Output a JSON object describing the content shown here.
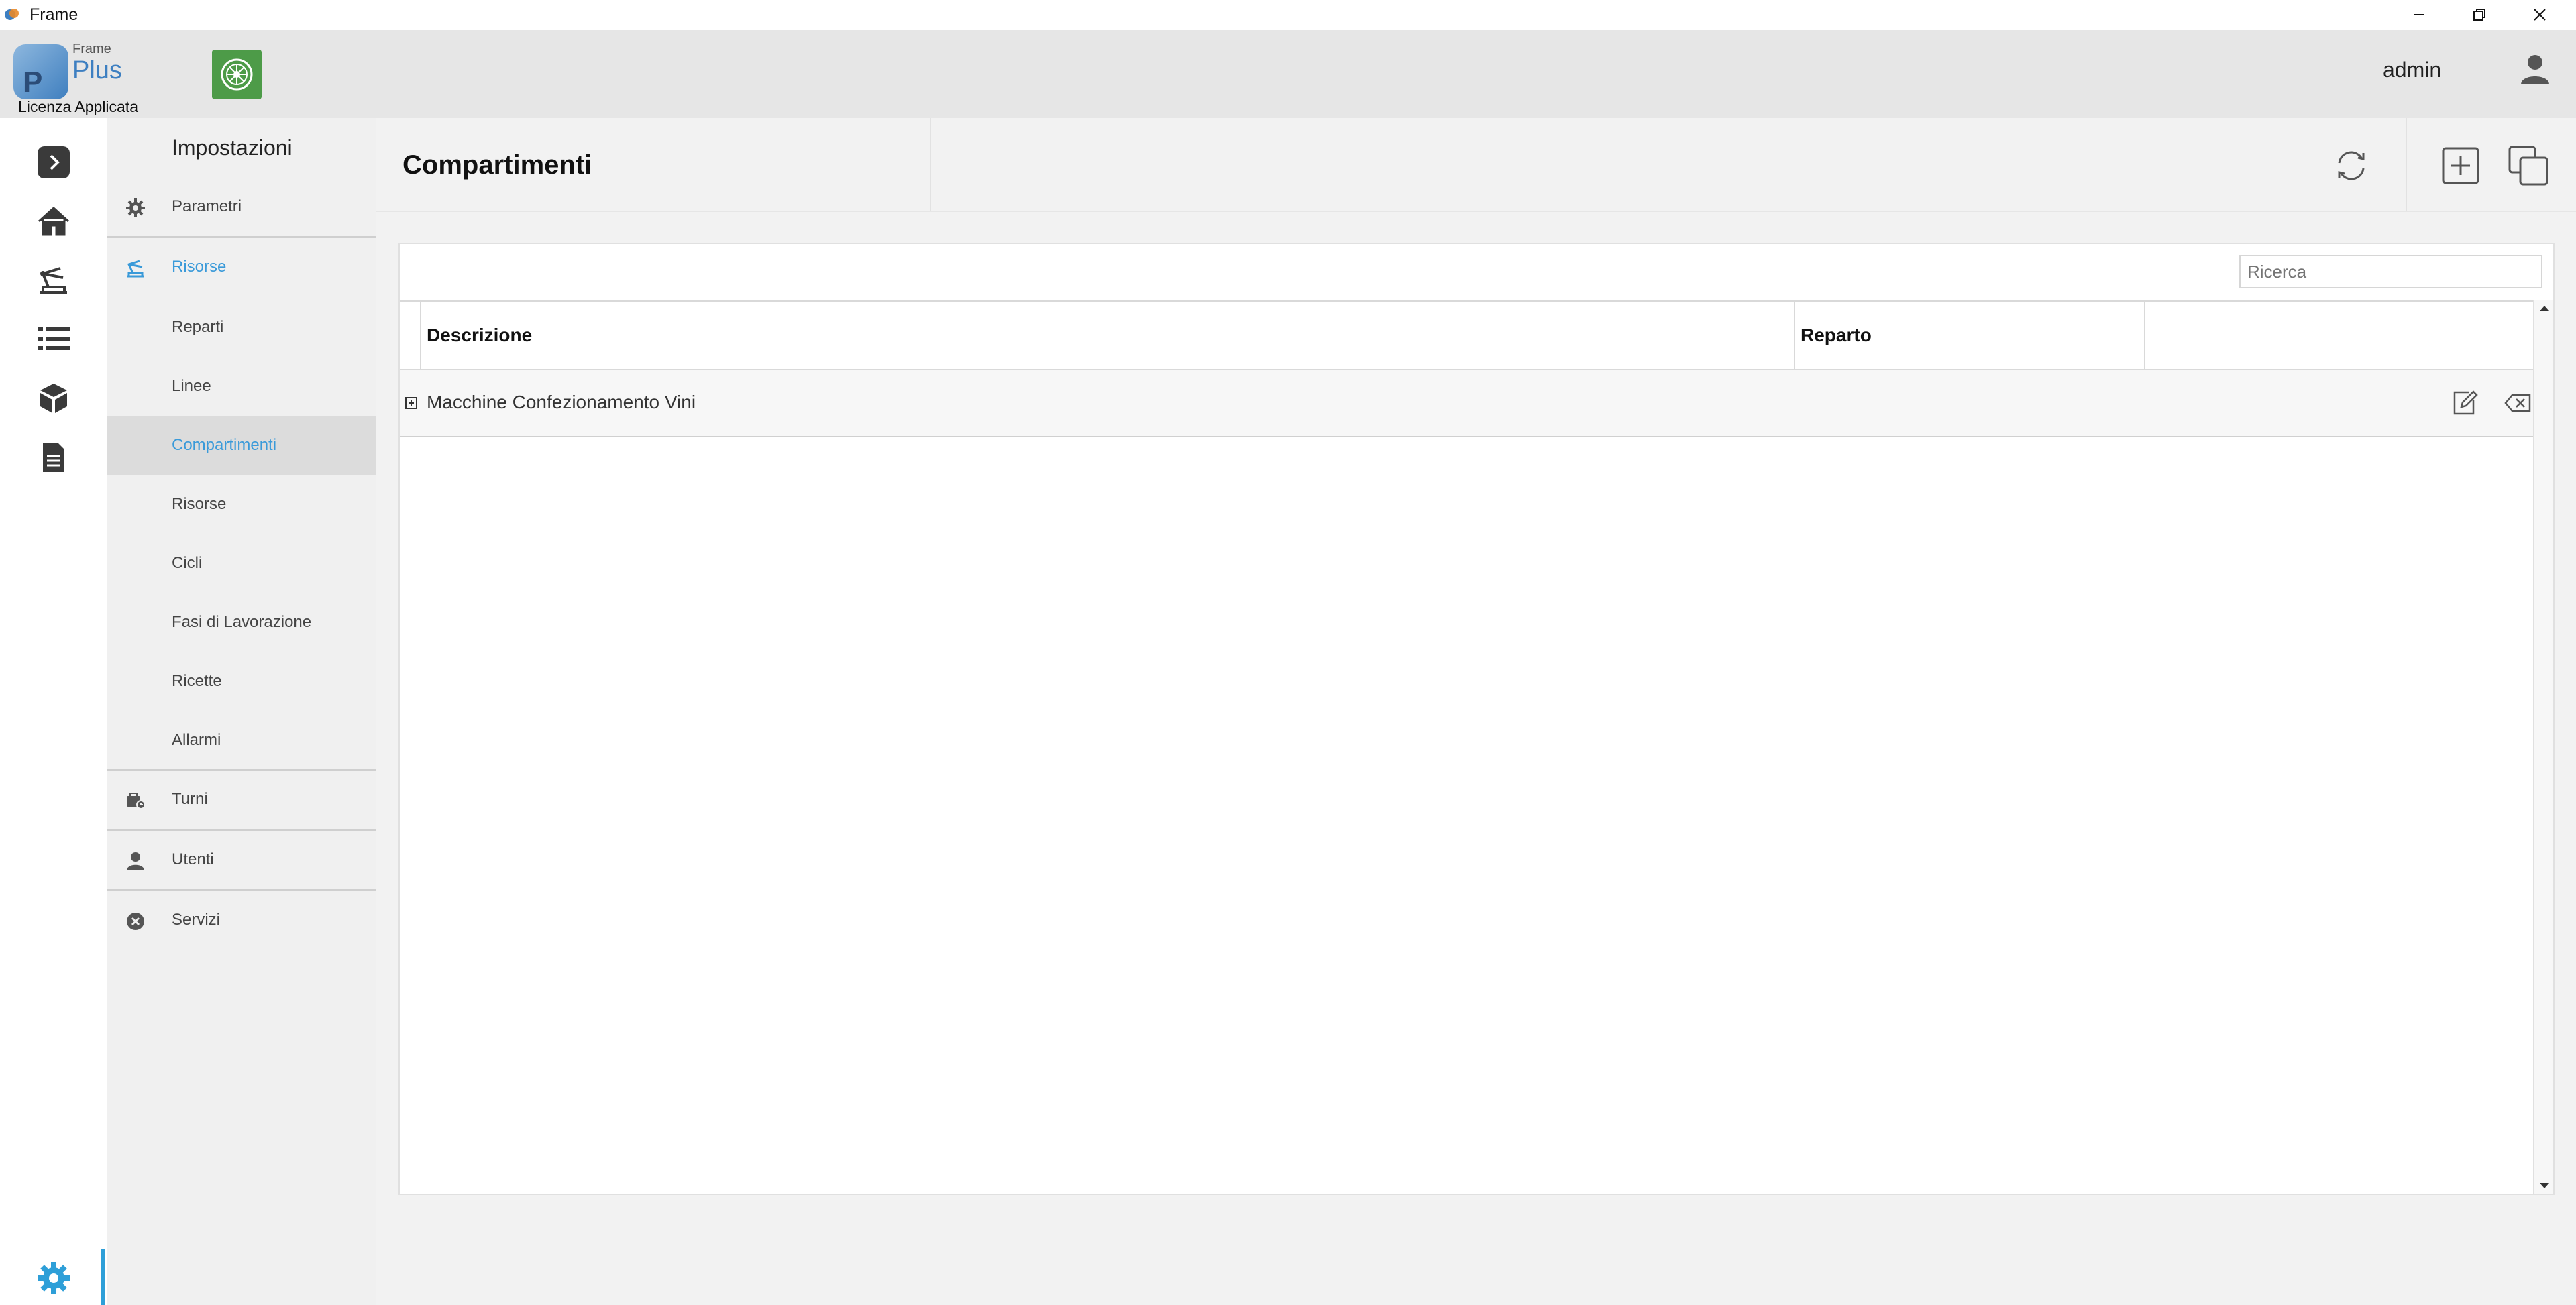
{
  "window": {
    "title": "Frame",
    "controls": [
      "minimize-icon",
      "restore-icon",
      "close-icon"
    ]
  },
  "header": {
    "logo_small": "Frame",
    "logo_big": "Plus",
    "logo_letter": "P",
    "license": "Licenza Applicata",
    "module_icon": "wheel-icon",
    "module_color": "#4d9b48",
    "user": "admin"
  },
  "rail": {
    "items": [
      "expand-icon",
      "home-icon",
      "machine-icon",
      "list-icon",
      "cube-icon",
      "document-icon"
    ],
    "active": "settings-icon",
    "accent": "#2e9fd8"
  },
  "menu": {
    "title": "Impostazioni",
    "items": [
      {
        "label": "Parametri",
        "icon": "gear-icon"
      },
      {
        "label": "Risorse",
        "icon": "resources-icon",
        "active": true
      },
      {
        "label": "Turni",
        "icon": "shifts-icon"
      },
      {
        "label": "Utenti",
        "icon": "user-icon"
      },
      {
        "label": "Servizi",
        "icon": "services-icon"
      }
    ],
    "subitems": [
      "Reparti",
      "Linee",
      "Compartimenti",
      "Risorse",
      "Cicli",
      "Fasi di Lavorazione",
      "Ricette",
      "Allarmi"
    ],
    "selected": "Compartimenti",
    "accent": "#3a9ad9"
  },
  "page": {
    "title": "Compartimenti",
    "tools": [
      "refresh-icon",
      "add-icon",
      "duplicate-icon"
    ]
  },
  "grid": {
    "search_placeholder": "Ricerca",
    "columns": [
      "Descrizione",
      "Reparto",
      ""
    ],
    "rows": [
      {
        "descrizione": "Macchine Confezionamento Vini",
        "reparto": ""
      }
    ]
  }
}
